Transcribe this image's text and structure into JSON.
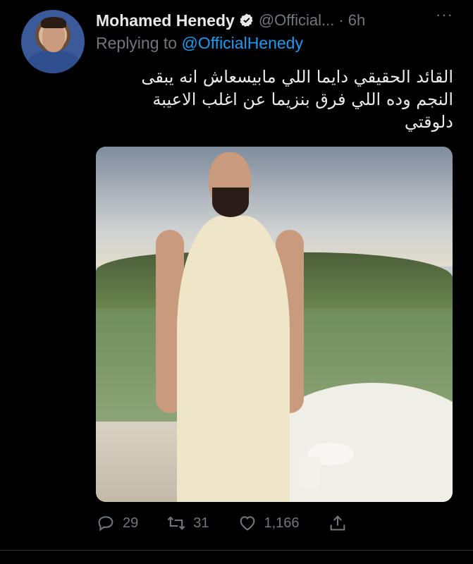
{
  "tweet": {
    "author_name": "Mohamed Henedy",
    "author_handle": "@Official...",
    "timestamp": "· 6h",
    "more_label": "···",
    "replying_prefix": "Replying to",
    "replying_to": "@OfficialHenedy",
    "text": "القائد الحقيقي دايما اللي مابيسعاش انه يبقى النجم  وده اللي فرق بنزيما عن اغلب الاعيبة دلوقتي",
    "actions": {
      "reply_count": "29",
      "retweet_count": "31",
      "like_count": "1,166"
    },
    "icons": {
      "verified": "verified-badge-icon",
      "more": "more-horizontal-icon",
      "reply": "reply-icon",
      "retweet": "retweet-icon",
      "like": "heart-icon",
      "share": "share-icon"
    }
  },
  "colors": {
    "background": "#000000",
    "text": "#e7e9ea",
    "secondary": "#71767b",
    "link": "#1d9bf0"
  }
}
